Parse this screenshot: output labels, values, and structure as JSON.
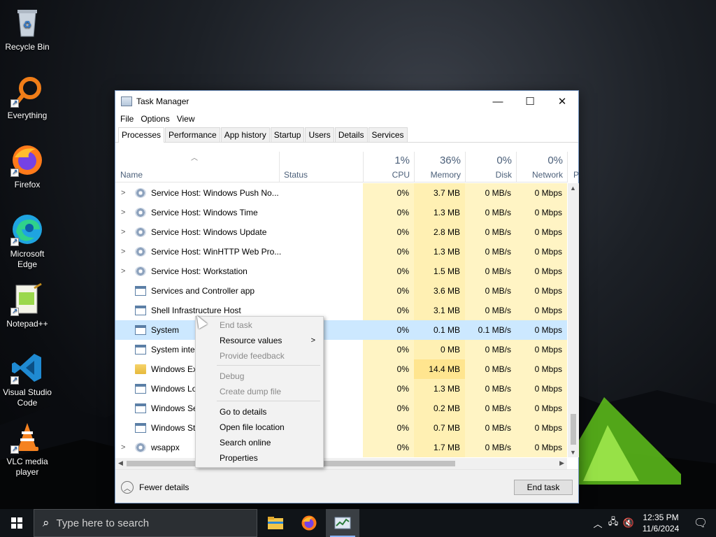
{
  "desktop": {
    "icons": [
      {
        "label": "Recycle Bin",
        "icon": "recycle-bin-icon"
      },
      {
        "label": "Everything",
        "icon": "everything-search-icon"
      },
      {
        "label": "Firefox",
        "icon": "firefox-icon"
      },
      {
        "label": "Microsoft Edge",
        "icon": "edge-icon"
      },
      {
        "label": "Notepad++",
        "icon": "notepad-plus-plus-icon"
      },
      {
        "label": "Visual Studio Code",
        "icon": "vscode-icon"
      },
      {
        "label": "VLC media player",
        "icon": "vlc-icon"
      }
    ]
  },
  "window": {
    "title": "Task Manager",
    "controls": {
      "minimize": "—",
      "maximize": "☐",
      "close": "✕"
    },
    "menu": [
      "File",
      "Options",
      "View"
    ],
    "tabs": [
      "Processes",
      "Performance",
      "App history",
      "Startup",
      "Users",
      "Details",
      "Services"
    ],
    "active_tab": "Processes"
  },
  "columns": {
    "name": "Name",
    "status": "Status",
    "cpu": {
      "pct": "1%",
      "label": "CPU"
    },
    "memory": {
      "pct": "36%",
      "label": "Memory"
    },
    "disk": {
      "pct": "0%",
      "label": "Disk"
    },
    "network": {
      "pct": "0%",
      "label": "Network"
    },
    "power_partial": "P"
  },
  "processes": [
    {
      "name": "Service Host: Windows Push No...",
      "icon": "gear",
      "expandable": true,
      "cpu": "0%",
      "memory": "3.7 MB",
      "disk": "0 MB/s",
      "network": "0 Mbps"
    },
    {
      "name": "Service Host: Windows Time",
      "icon": "gear",
      "expandable": true,
      "cpu": "0%",
      "memory": "1.3 MB",
      "disk": "0 MB/s",
      "network": "0 Mbps"
    },
    {
      "name": "Service Host: Windows Update",
      "icon": "gear",
      "expandable": true,
      "cpu": "0%",
      "memory": "2.8 MB",
      "disk": "0 MB/s",
      "network": "0 Mbps"
    },
    {
      "name": "Service Host: WinHTTP Web Pro...",
      "icon": "gear",
      "expandable": true,
      "cpu": "0%",
      "memory": "1.3 MB",
      "disk": "0 MB/s",
      "network": "0 Mbps"
    },
    {
      "name": "Service Host: Workstation",
      "icon": "gear",
      "expandable": true,
      "cpu": "0%",
      "memory": "1.5 MB",
      "disk": "0 MB/s",
      "network": "0 Mbps"
    },
    {
      "name": "Services and Controller app",
      "icon": "win",
      "expandable": false,
      "cpu": "0%",
      "memory": "3.6 MB",
      "disk": "0 MB/s",
      "network": "0 Mbps"
    },
    {
      "name": "Shell Infrastructure Host",
      "icon": "win",
      "expandable": false,
      "cpu": "0%",
      "memory": "3.1 MB",
      "disk": "0 MB/s",
      "network": "0 Mbps"
    },
    {
      "name": "System",
      "icon": "win",
      "expandable": false,
      "selected": true,
      "cpu": "0%",
      "memory": "0.1 MB",
      "disk": "0.1 MB/s",
      "network": "0 Mbps"
    },
    {
      "name": "System inter",
      "icon": "win",
      "expandable": false,
      "cpu": "0%",
      "memory": "0 MB",
      "disk": "0 MB/s",
      "network": "0 Mbps"
    },
    {
      "name": "Windows Ex",
      "icon": "folder",
      "expandable": false,
      "cpu": "0%",
      "memory": "14.4 MB",
      "disk": "0 MB/s",
      "network": "0 Mbps"
    },
    {
      "name": "Windows Lo",
      "icon": "win",
      "expandable": false,
      "cpu": "0%",
      "memory": "1.3 MB",
      "disk": "0 MB/s",
      "network": "0 Mbps"
    },
    {
      "name": "Windows Se",
      "icon": "win",
      "expandable": false,
      "cpu": "0%",
      "memory": "0.2 MB",
      "disk": "0 MB/s",
      "network": "0 Mbps"
    },
    {
      "name": "Windows St",
      "icon": "win",
      "expandable": false,
      "cpu": "0%",
      "memory": "0.7 MB",
      "disk": "0 MB/s",
      "network": "0 Mbps"
    },
    {
      "name": "wsappx",
      "icon": "gear",
      "expandable": true,
      "cpu": "0%",
      "memory": "1.7 MB",
      "disk": "0 MB/s",
      "network": "0 Mbps"
    }
  ],
  "context_menu": {
    "items": [
      {
        "label": "End task",
        "disabled": true
      },
      {
        "label": "Resource values",
        "disabled": false,
        "submenu": true
      },
      {
        "label": "Provide feedback",
        "disabled": true
      },
      {
        "label": "Debug",
        "disabled": true
      },
      {
        "label": "Create dump file",
        "disabled": true
      },
      {
        "label": "Go to details",
        "disabled": false
      },
      {
        "label": "Open file location",
        "disabled": false
      },
      {
        "label": "Search online",
        "disabled": false
      },
      {
        "label": "Properties",
        "disabled": false
      }
    ]
  },
  "footer": {
    "fewer_details": "Fewer details",
    "end_task": "End task"
  },
  "taskbar": {
    "search_placeholder": "Type here to search",
    "apps": [
      "file-explorer-icon",
      "firefox-icon",
      "task-manager-icon"
    ],
    "time": "12:35 PM",
    "date": "11/6/2024"
  }
}
